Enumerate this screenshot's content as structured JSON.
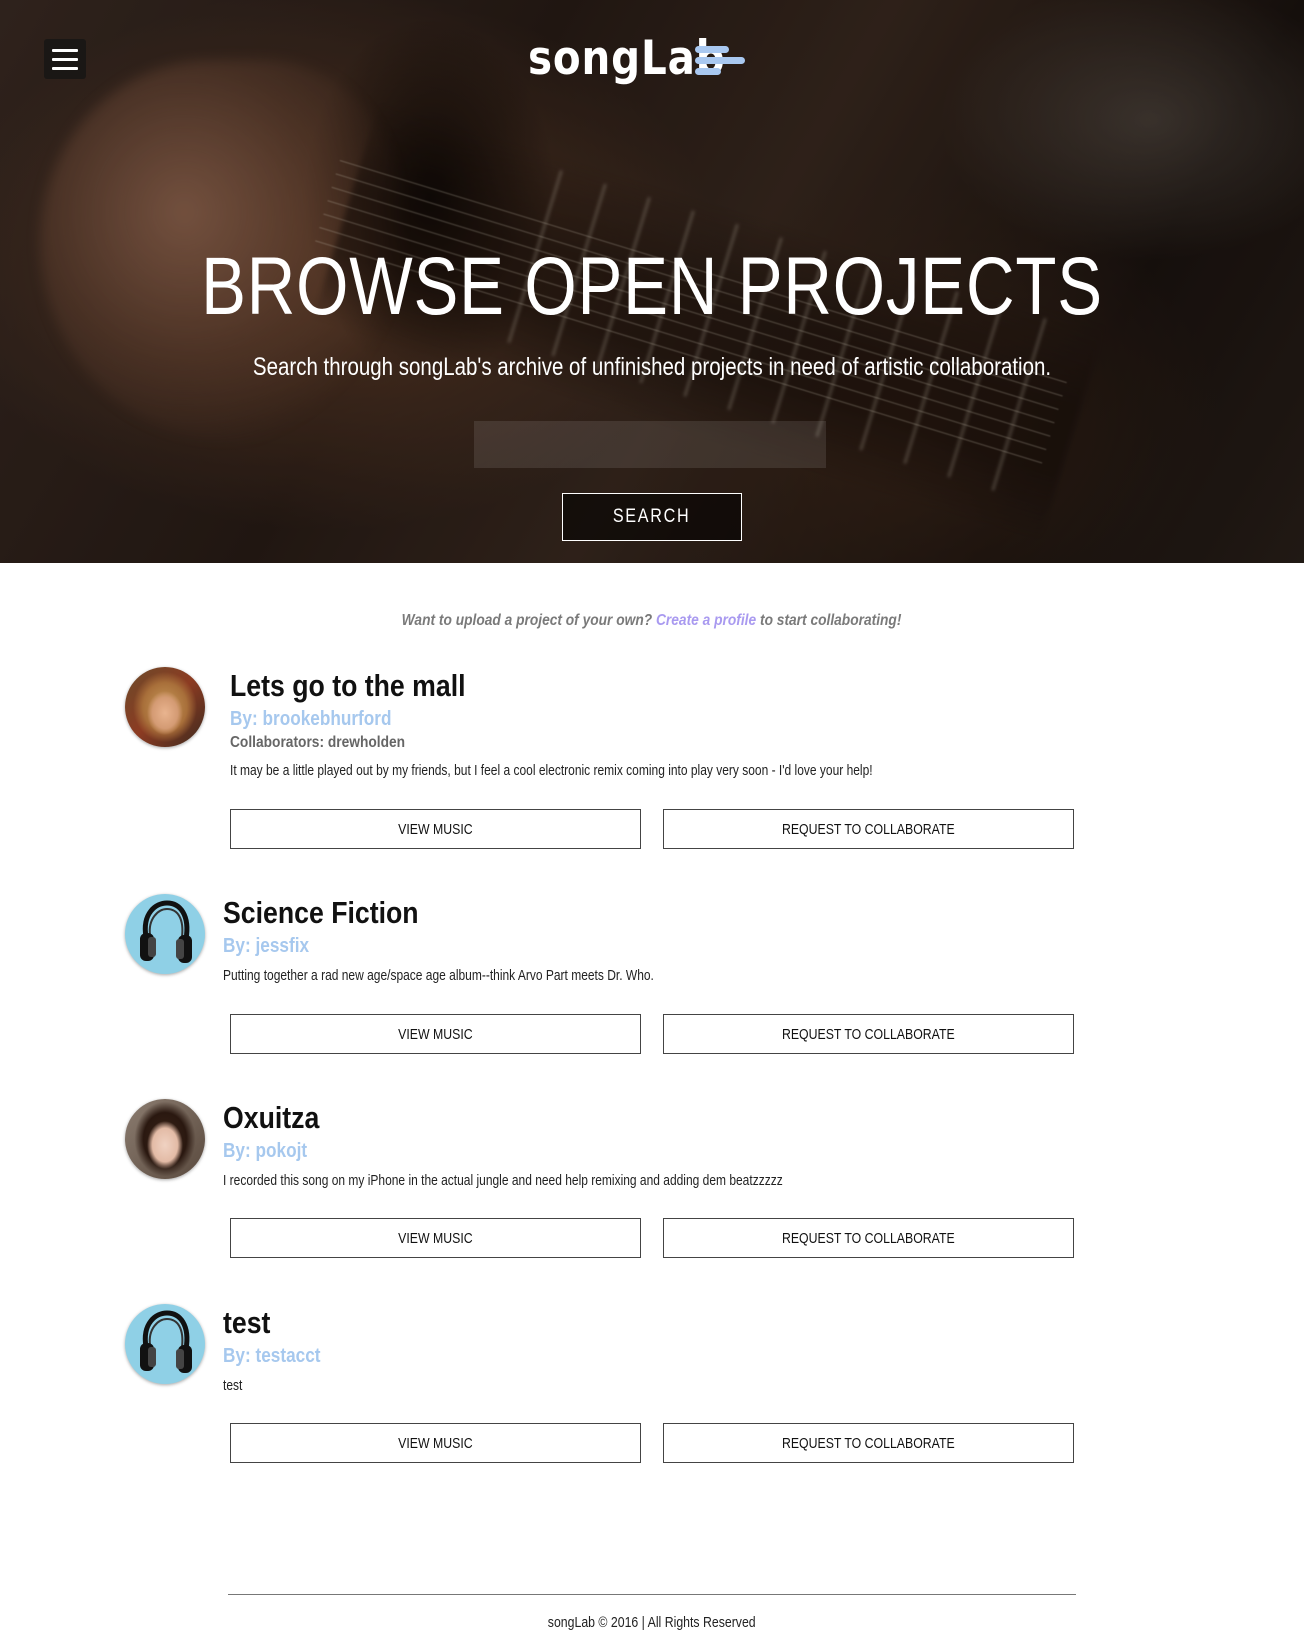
{
  "header": {
    "logo_text": "songLab",
    "logo_accent": "#a9c8f0",
    "menu_icon": "hamburger-menu-icon"
  },
  "hero": {
    "title": "BROWSE OPEN PROJECTS",
    "subtitle": "Search through songLab's archive of unfinished projects in need of artistic collaboration.",
    "search_value": "",
    "search_placeholder": "",
    "search_button": "SEARCH"
  },
  "promo": {
    "before": "Want to upload a project of your own?",
    "link": "Create a profile",
    "after": "to start collaborating!"
  },
  "projects": [
    {
      "title": "Lets go to the mall",
      "author": "By: brookebhurford",
      "collaborators": "Collaborators: drewholden",
      "description": "It may be a little played out by my friends, but I feel a cool electronic remix coming into play very soon - I'd love your help!",
      "view_label": "VIEW MUSIC",
      "request_label": "REQUEST TO COLLABORATE"
    },
    {
      "title": "Science Fiction",
      "author": "By: jessfix",
      "description": "Putting together a rad new age/space age album--think Arvo Part meets Dr. Who.",
      "view_label": "VIEW MUSIC",
      "request_label": "REQUEST TO COLLABORATE"
    },
    {
      "title": "Oxuitza",
      "author": "By: pokojt",
      "description": "I recorded this song on my iPhone in the actual jungle and need help remixing and adding dem beatzzzzz",
      "view_label": "VIEW MUSIC",
      "request_label": "REQUEST TO COLLABORATE"
    },
    {
      "title": "test",
      "author": "By: testacct",
      "description": "test",
      "view_label": "VIEW MUSIC",
      "request_label": "REQUEST TO COLLABORATE"
    }
  ],
  "footer": {
    "text": "songLab © 2016 | All Rights Reserved"
  },
  "colors": {
    "author_blue": "#a6c8ee",
    "link_purple": "#a99af0",
    "headphone_avatar_bg": "#8fd0e6"
  }
}
